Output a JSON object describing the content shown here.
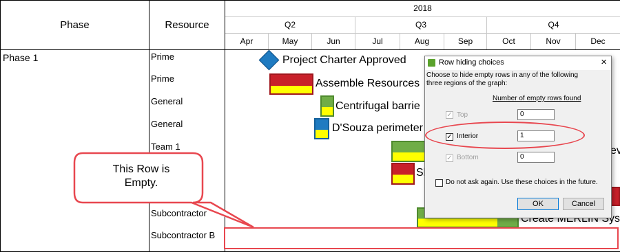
{
  "header": {
    "phase_col": "Phase",
    "resource_col": "Resource",
    "year": "2018",
    "quarters": [
      "Q2",
      "Q3",
      "Q4"
    ],
    "months": [
      "Apr",
      "May",
      "Jun",
      "Jul",
      "Aug",
      "Sep",
      "Oct",
      "Nov",
      "Dec"
    ]
  },
  "phase_name": "Phase 1",
  "resources": [
    "Prime",
    "Prime",
    "General",
    "General",
    "Team 1",
    "",
    "",
    "Subcontractor",
    "Subcontractor B"
  ],
  "tasks": [
    {
      "label": "Project Charter Approved"
    },
    {
      "label": "Assemble Resources"
    },
    {
      "label": "Centrifugal barrie"
    },
    {
      "label": "D'Souza perimeter"
    },
    {
      "label": "ev"
    },
    {
      "label": "Sl"
    },
    {
      "label": "Create MERLIN Syst"
    }
  ],
  "colors": {
    "red": "#c8202a",
    "yellow": "#ffff00",
    "green": "#70ad47",
    "blue": "#1f7bc1",
    "callout_border": "#e8474f",
    "accent": "#0078d7"
  },
  "callout": {
    "line1": "This Row is",
    "line2": "Empty."
  },
  "dialog": {
    "title": "Row hiding choices",
    "close": "×",
    "intro": "Choose to hide empty rows in any of the following three regions of the graph:",
    "col_header": "Number of empty rows found",
    "options": [
      {
        "label": "Top",
        "checked": "✓",
        "value": "0"
      },
      {
        "label": "Interior",
        "checked": "✓",
        "value": "1"
      },
      {
        "label": "Bottom",
        "checked": "✓",
        "value": "0"
      }
    ],
    "dont_ask": "Do not ask again.   Use these choices in the future.",
    "ok": "OK",
    "cancel": "Cancel"
  }
}
